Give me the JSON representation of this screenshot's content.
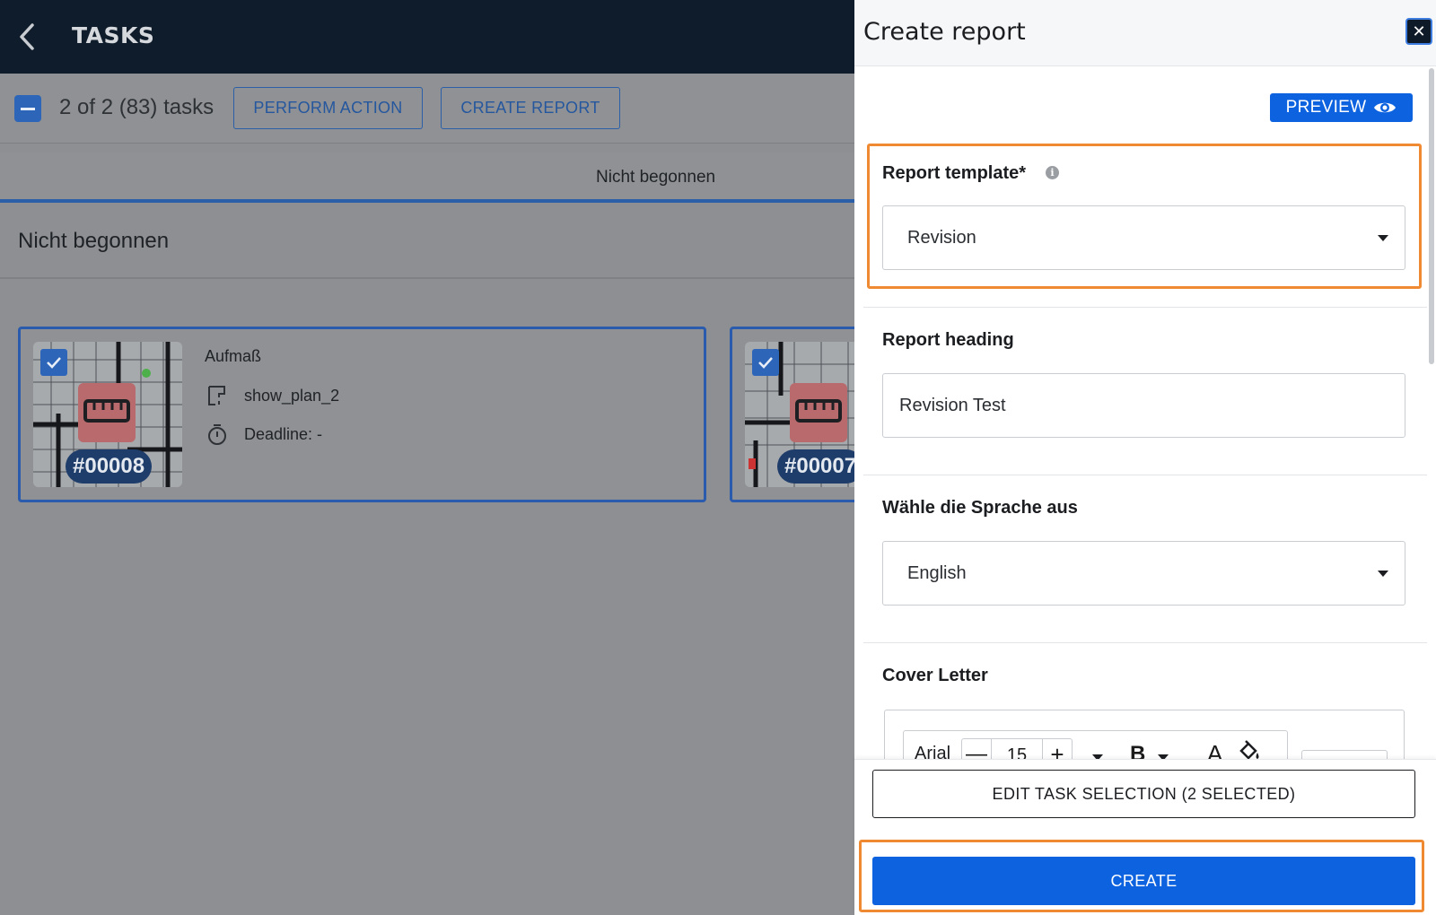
{
  "app": {
    "title": "TASKS",
    "selection_count": "2 of 2 (83) tasks",
    "perform_action_label": "PERFORM ACTION",
    "create_report_label": "CREATE REPORT",
    "status_tab": "Nicht begonnen",
    "section_title": "Nicht begonnen",
    "cards": [
      {
        "id": "#00008",
        "name": "Aufmaß",
        "plan": "show_plan_2",
        "deadline": "Deadline: -"
      },
      {
        "id": "#00007"
      }
    ]
  },
  "panel": {
    "title": "Create report",
    "close_icon": "close-icon",
    "preview_label": "PREVIEW",
    "template": {
      "label": "Report template*",
      "value": "Revision"
    },
    "heading": {
      "label": "Report heading",
      "value": "Revision Test"
    },
    "language": {
      "label": "Wähle die Sprache aus",
      "value": "English"
    },
    "cover_letter": {
      "label": "Cover Letter",
      "font": "Arial",
      "minus": "—",
      "size": "15",
      "plus": "+",
      "bold": "B",
      "text_color": "A"
    },
    "edit_selection_label": "EDIT TASK SELECTION (2 SELECTED)",
    "create_label": "CREATE"
  },
  "colors": {
    "accent": "#0d62df",
    "highlight": "#f08a32",
    "topbar": "#0f1c2b"
  }
}
